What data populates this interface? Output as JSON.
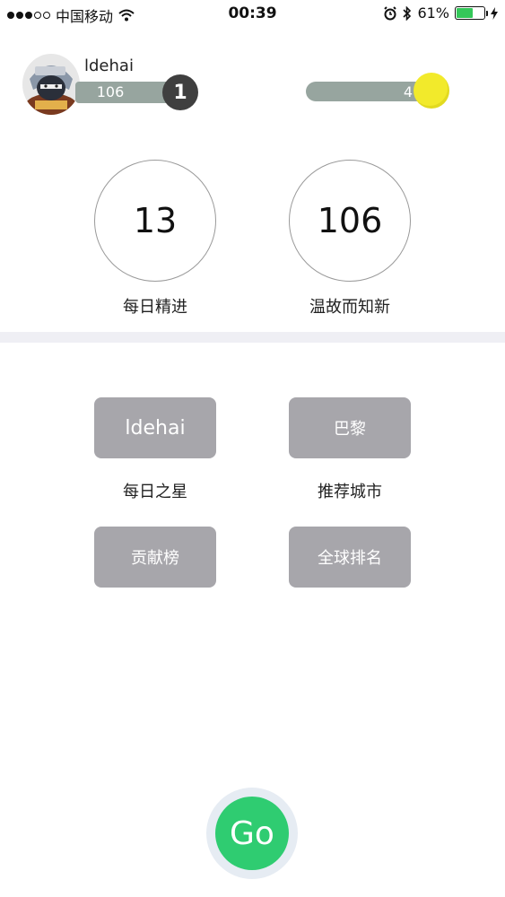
{
  "status_bar": {
    "carrier": "中国移动",
    "time": "00:39",
    "battery_percent": "61%",
    "battery_level": 0.61,
    "icons": [
      "wifi-icon",
      "alarm-icon",
      "bluetooth-icon",
      "charging-icon"
    ]
  },
  "profile": {
    "username": "ldehai",
    "xp": "106",
    "level": "1",
    "coins": "4"
  },
  "stats": [
    {
      "value": "13",
      "label": "每日精进"
    },
    {
      "value": "106",
      "label": "温故而知新"
    }
  ],
  "tiles": {
    "daily_star": {
      "button": "ldehai",
      "caption": "每日之星"
    },
    "recommended_city": {
      "button": "巴黎",
      "caption": "推荐城市"
    },
    "contribution": {
      "button": "贡献榜"
    },
    "global_rank": {
      "button": "全球排名"
    }
  },
  "go_label": "Go",
  "colors": {
    "tile": "#a7a6ab",
    "go": "#2fcc71",
    "coin": "#f2ea2b",
    "progress": "#97a59f"
  }
}
